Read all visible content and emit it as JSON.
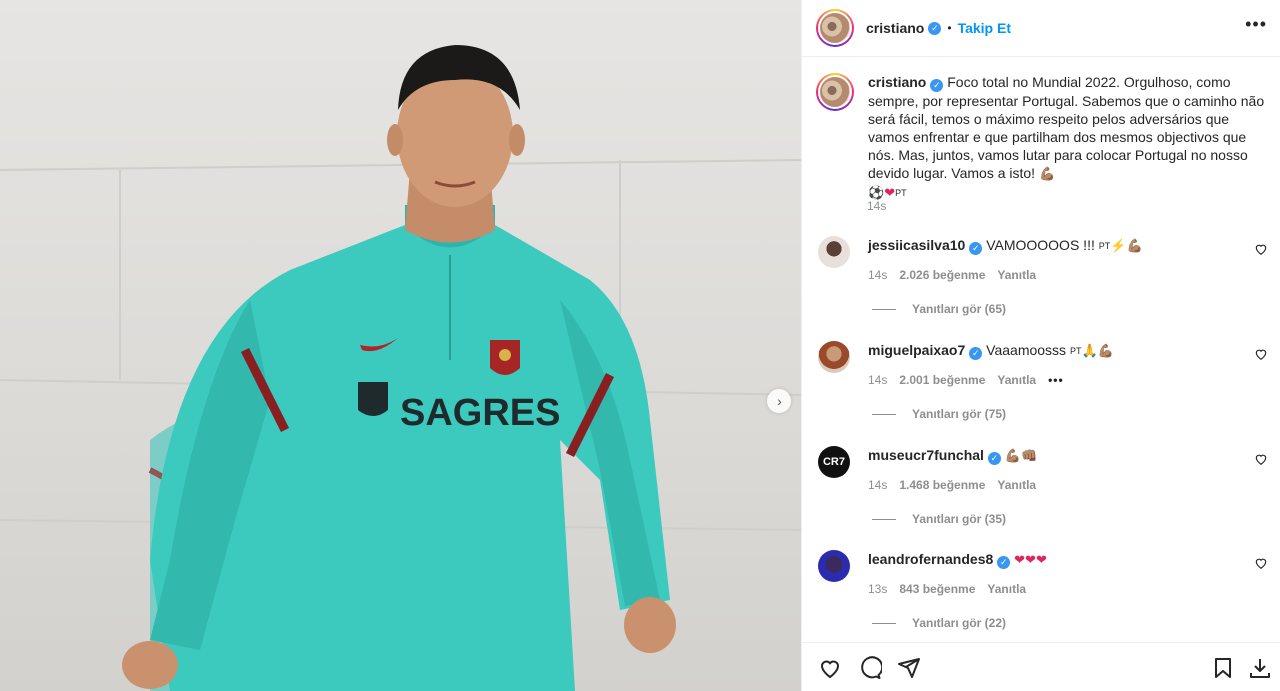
{
  "post": {
    "username": "cristiano",
    "follow_label": "Takip Et",
    "separator": "•",
    "more_label": "•••",
    "caption": "Foco total no Mundial 2022. Orgulhoso, como sempre, por representar Portugal. Sabemos que o caminho não será fácil, temos o máximo respeito pelos adversários que vamos enfrentar e que partilham dos mesmos objectivos que nós. Mas, juntos, vamos lutar para colocar Portugal no nosso devido lugar. Vamos a isto!",
    "caption_emoji_end": "💪🏽",
    "caption_emoji_line": "⚽",
    "caption_heart": "❤",
    "caption_flag": "PT",
    "time": "14s",
    "photo_jersey_text": "SAGRES"
  },
  "comments": [
    {
      "username": "jessiicasilva10",
      "text": "VAMOOOOOS !!! ",
      "flag": "PT",
      "emoji": "⚡💪🏽",
      "time": "14s",
      "likes": "2.026 beğenme",
      "reply_label": "Yanıtla",
      "replies": "Yanıtları gör (65)"
    },
    {
      "username": "miguelpaixao7",
      "text": "Vaaamoosss ",
      "flag": "PT",
      "emoji": "🙏💪🏽",
      "time": "14s",
      "likes": "2.001 beğenme",
      "reply_label": "Yanıtla",
      "options": "•••",
      "replies": "Yanıtları gör (75)"
    },
    {
      "username": "museucr7funchal",
      "text": "",
      "flag": "",
      "emoji": "💪🏽👊🏽",
      "time": "14s",
      "likes": "1.468 beğenme",
      "reply_label": "Yanıtla",
      "replies": "Yanıtları gör (35)"
    },
    {
      "username": "leandrofernandes8",
      "text": "",
      "flag": "",
      "emoji": "❤❤❤",
      "time": "13s",
      "likes": "843 beğenme",
      "reply_label": "Yanıtla",
      "replies": "Yanıtları gör (22)"
    }
  ],
  "avatars": {
    "museu_label": "CR7"
  },
  "next_arrow": "›",
  "icons": [
    "heart-icon",
    "comment-icon",
    "share-icon",
    "bookmark-icon",
    "download-icon"
  ]
}
